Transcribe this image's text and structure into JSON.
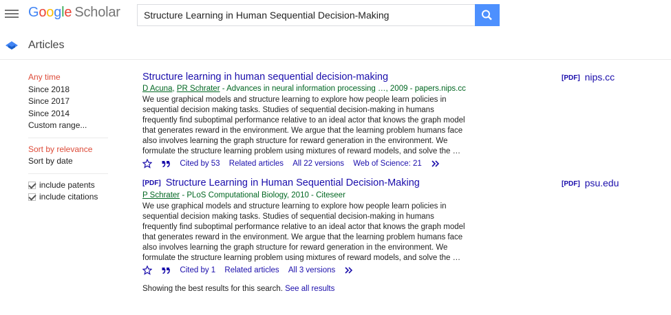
{
  "header": {
    "logo_google": [
      "G",
      "o",
      "o",
      "g",
      "l",
      "e"
    ],
    "logo_scholar": "Scholar",
    "search_value": "Structure Learning in Human Sequential Decision-Making",
    "menu_icon": "hamburger-menu-icon",
    "search_icon": "search-icon"
  },
  "subheader": {
    "title": "Articles",
    "icon": "graduation-cap-icon"
  },
  "sidebar": {
    "time": [
      "Any time",
      "Since 2018",
      "Since 2017",
      "Since 2014",
      "Custom range..."
    ],
    "sort": [
      "Sort by relevance",
      "Sort by date"
    ],
    "checks": [
      "include patents",
      "include citations"
    ]
  },
  "results": [
    {
      "title_prefix": "",
      "title": "Structure learning in human sequential decision-making",
      "author1": "D Acuna",
      "author_sep": ",",
      "author2": "PR Schrater",
      "source": " - Advances in neural information processing …, 2009 - papers.nips.cc",
      "snippet": "We use graphical models and structure learning to explore how people learn policies in sequential decision making tasks. Studies of sequential decision-making in humans frequently find suboptimal performance relative to an ideal actor that knows the graph model that generates reward in the environment. We argue that the learning problem humans face also involves learning the graph structure for reward generation in the environment. We formulate the structure learning problem using mixtures of reward models, and solve the …",
      "cited_by": "Cited by 53",
      "related": "Related articles",
      "versions": "All 22 versions",
      "extra": "Web of Science: 21",
      "side_tag": "[PDF]",
      "side_host": "nips.cc"
    },
    {
      "title_prefix": "[PDF]",
      "title": "Structure Learning in Human Sequential Decision-Making",
      "author1": "P Schrater",
      "author_sep": "",
      "author2": "",
      "source": " - PLoS Computational Biology, 2010 - Citeseer",
      "snippet": "We use graphical models and structure learning to explore how people learn policies in sequential decision making tasks. Studies of sequential decision-making in humans frequently find suboptimal performance relative to an ideal actor that knows the graph model that generates reward in the environment. We argue that the learning problem humans face also involves learning the graph structure for reward generation in the environment. We formulate the structure learning problem using mixtures of reward models, and solve the …",
      "cited_by": "Cited by 1",
      "related": "Related articles",
      "versions": "All 3 versions",
      "extra": "",
      "side_tag": "[PDF]",
      "side_host": "psu.edu"
    }
  ],
  "footer": {
    "text": "Showing the best results for this search.",
    "link": "See all results"
  },
  "colors": {
    "link": "#1a0dab",
    "green": "#006621",
    "active": "#dd4b39",
    "search_button": "#4d90fe"
  }
}
